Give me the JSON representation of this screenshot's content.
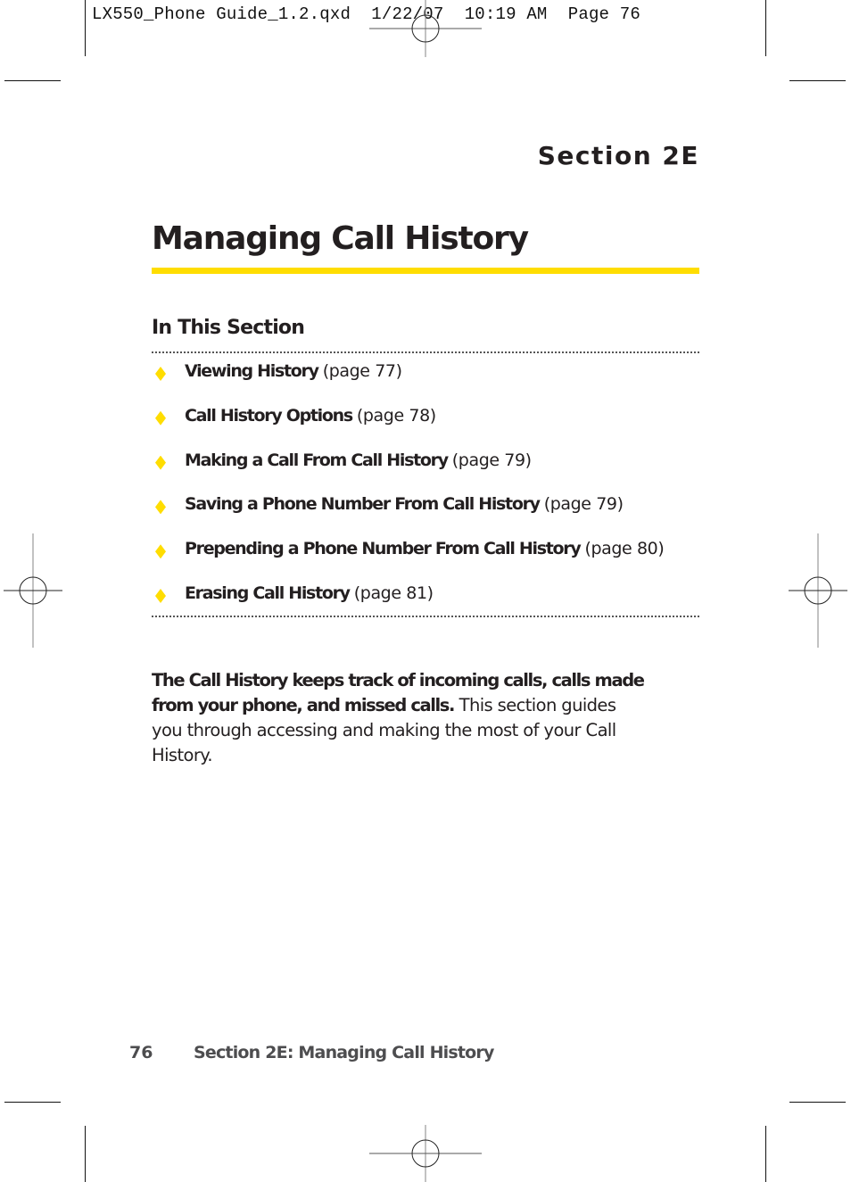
{
  "slug": {
    "filename": "LX550_Phone Guide_1.2.qxd",
    "date": "1/22/07",
    "time": "10:19 AM",
    "page": "Page 76"
  },
  "header": {
    "section_label": "Section 2E",
    "title": "Managing Call History"
  },
  "colors": {
    "accent": "#ffdd00",
    "text": "#231f20",
    "footer_text": "#4d4d4f"
  },
  "in_this_section": {
    "heading": "In This Section",
    "items": [
      {
        "title": "Viewing History",
        "page": "(page 77)"
      },
      {
        "title": "Call History Options",
        "page": "(page 78)"
      },
      {
        "title": "Making a Call From Call History",
        "page": "(page 79)"
      },
      {
        "title": "Saving a Phone Number From Call History",
        "page": "(page 79)"
      },
      {
        "title": "Prepending a Phone Number From Call History",
        "page": "(page 80)"
      },
      {
        "title": "Erasing Call History",
        "page": "(page 81)"
      }
    ]
  },
  "intro": {
    "bold": "The Call History keeps track of incoming calls, calls made from your phone, and missed calls.",
    "regular": " This section guides you through accessing and making the most of your Call History."
  },
  "footer": {
    "page_number": "76",
    "running_title": "Section 2E: Managing Call History"
  }
}
